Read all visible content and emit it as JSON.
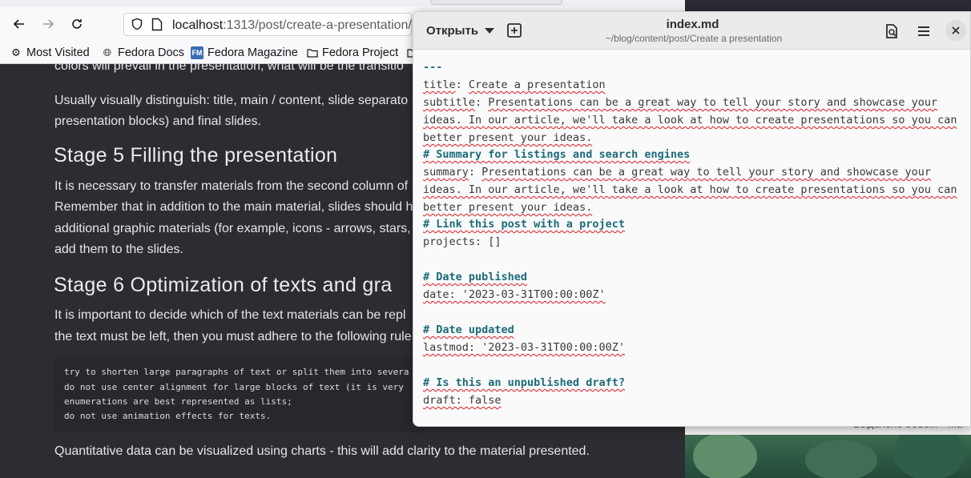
{
  "browser": {
    "url_host": "localhost",
    "url_path": ":1313/post/create-a-presentation/",
    "bookmarks": [
      "Most Visited",
      "Fedora Docs",
      "Fedora Magazine",
      "Fedora Project"
    ]
  },
  "article": {
    "frag1": "colors will prevail in the presentation, what will be the transitio",
    "p1_line1": "Usually visually distinguish: title, main / content, slide separato",
    "p1_line2": "presentation blocks) and final slides.",
    "h_stage5": "Stage 5 Filling the presentation",
    "p2_line1": "It is necessary to transfer materials from the second column of",
    "p2_line2": "Remember that in addition to the main material, slides should h",
    "p2_line3": "additional graphic materials (for example, icons - arrows, stars,",
    "p2_line4": "add them to the slides.",
    "h_stage6": "Stage 6 Optimization of texts and gra",
    "p3_line1": "It is important to decide which of the text materials can be repl",
    "p3_line2": "the text must be left, then you must adhere to the following rule",
    "code": [
      "try to shorten large paragraphs of text or split them into severa",
      "do not use center alignment for large blocks of text (it is very",
      "enumerations are best represented as lists;",
      "do not use animation effects for texts."
    ],
    "p4": "Quantitative data can be visualized using charts - this will add clarity to the material presented."
  },
  "editor": {
    "open_label": "Открыть",
    "title": "index.md",
    "subtitle": "~/blog/content/post/Create a presentation",
    "lines": {
      "l1": "---",
      "l2_key": "title",
      "l2_val": "Create a presentation",
      "l3_key": "subtitle",
      "l3_val": "Presentations can be a great way to tell your story and showcase your",
      "l4": "ideas. In our article, we'll take a look at how to create presentations so you can",
      "l5": "better present your ideas.",
      "l6": "# Summary for listings and search engines",
      "l7_key": "summary",
      "l7_val": "Presentations can be a great way to tell your story and showcase your",
      "l8": "ideas. In our article, we'll take a look at how to create presentations so you can",
      "l9": "better present your ideas.",
      "l10": "# Link this post with a project",
      "l11": "projects: []",
      "l12": "# Date published",
      "l13": "date: '2023-03-31T00:00:00Z'",
      "l14": "# Date updated",
      "l15": "lastmod: '2023-03-31T00:00:00Z'",
      "l16": "# Is this an unpublished draft?",
      "l17": "draft: false"
    }
  },
  "behind_window_text": "Выделено объект · ma"
}
